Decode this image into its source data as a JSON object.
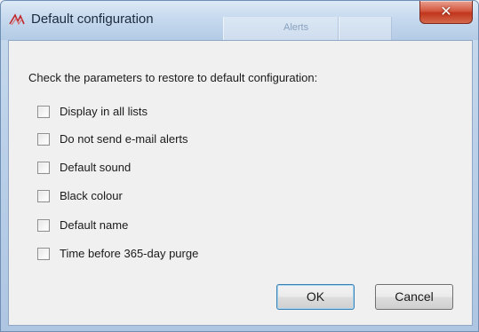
{
  "window": {
    "title": "Default configuration",
    "background_hint": "Alerts",
    "close_symbol": "✕"
  },
  "dialog": {
    "instruction": "Check the parameters to restore to default configuration:",
    "options": [
      {
        "label": "Display in all lists",
        "checked": false
      },
      {
        "label": "Do not send e-mail alerts",
        "checked": false
      },
      {
        "label": "Default sound",
        "checked": false
      },
      {
        "label": "Black colour",
        "checked": false
      },
      {
        "label": "Default name",
        "checked": false
      },
      {
        "label": "Time before 365-day purge",
        "checked": false
      }
    ],
    "ok_label": "OK",
    "cancel_label": "Cancel"
  },
  "icons": {
    "app": "app-logo-icon",
    "close": "close-icon"
  },
  "colors": {
    "close_button": "#c9432a",
    "title_bar": "#c6d9ee",
    "dialog_bg": "#f0f0f0"
  }
}
